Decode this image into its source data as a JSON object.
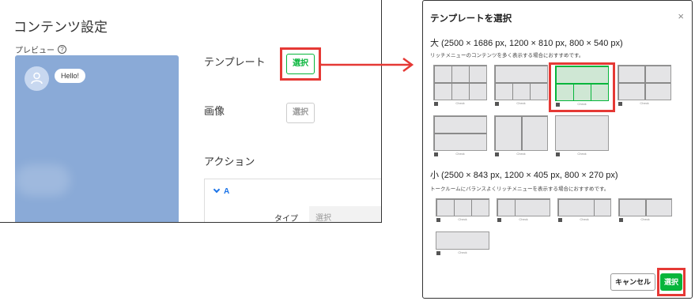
{
  "left": {
    "title": "コンテンツ設定",
    "preview_label": "プレビュー",
    "help_icon": "?",
    "bubble": "Hello!",
    "template_label": "テンプレート",
    "template_button": "選択",
    "image_label": "画像",
    "image_button": "選択",
    "action_label": "アクション",
    "action_item": "A",
    "type_label": "タイプ",
    "type_placeholder": "選択"
  },
  "modal": {
    "title": "テンプレートを選択",
    "close": "×",
    "large": {
      "title": "大 (2500 × 1686 px, 1200 × 810 px, 800 × 540 px)",
      "subtitle": "リッチメニューのコンテンツを多く表示する場合におすすめです。"
    },
    "small": {
      "title": "小 (2500 × 843 px, 1200 × 405 px, 800 × 270 px)",
      "subtitle": "トークルームにバランスよくリッチメニューを表示する場合におすすめです。"
    },
    "thumb_caption": "Check",
    "cancel_button": "キャンセル",
    "select_button": "選択"
  },
  "colors": {
    "green": "#07b53b",
    "highlight_red": "#e53935",
    "preview_bg": "#8aaad7"
  }
}
